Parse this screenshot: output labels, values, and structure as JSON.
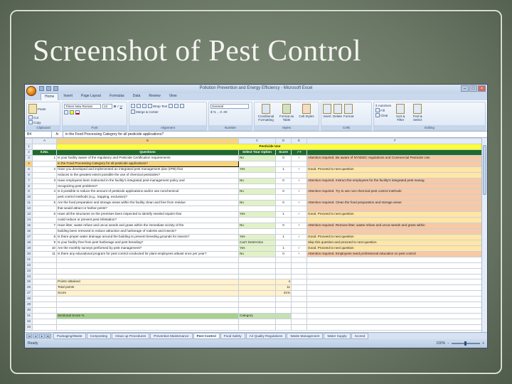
{
  "slide": {
    "title": "Screenshot of Pest Control"
  },
  "window": {
    "title": "Pollution Prevention and Energy Efficiency - Microsoft Excel"
  },
  "ribbon_tabs": [
    "Home",
    "Insert",
    "Page Layout",
    "Formulas",
    "Data",
    "Review",
    "View"
  ],
  "ribbon": {
    "clipboard": {
      "label": "Clipboard",
      "paste": "Paste",
      "cut": "Cut",
      "copy": "Copy",
      "format_painter": "Format Painter"
    },
    "font": {
      "label": "Font",
      "font_name": "Times New Roman",
      "font_size": "12"
    },
    "alignment": {
      "label": "Alignment",
      "wrap": "Wrap Text",
      "merge": "Merge & Center"
    },
    "number": {
      "label": "Number",
      "format": "General"
    },
    "styles": {
      "label": "Styles",
      "conditional": "Conditional Formatting",
      "format_table": "Format as Table",
      "cell_styles": "Cell Styles"
    },
    "cells": {
      "label": "Cells",
      "insert": "Insert",
      "delete": "Delete",
      "format": "Format"
    },
    "editing": {
      "label": "Editing",
      "autosum": "AutoSum",
      "fill": "Fill",
      "clear": "Clear",
      "sort": "Sort & Filter",
      "find": "Find & Select"
    }
  },
  "formula_bar": {
    "name_box": "B4",
    "fx": "fx",
    "content": "in the Food Processing Category for all pesticide applications?"
  },
  "sheet": {
    "col_heads": [
      "",
      "A",
      "B",
      "C",
      "D",
      "E",
      "F"
    ],
    "row1_title": "Pesticide Use",
    "headers": [
      "S.No.",
      "Questions",
      "Select Your Option",
      "Score",
      "✓×",
      ""
    ],
    "rows": [
      [
        "1",
        "Is your facility aware of the regulatory and Pesticide Certification requirements",
        "No",
        "0",
        "×",
        "Attention required. Be aware of NYSDEC regulations and Commercial Pesticide Use"
      ],
      [
        "",
        "in the Food Processing Category for all pesticide applications?",
        "",
        "",
        "",
        ""
      ],
      [
        "2",
        "Have you developed and implemented an integrated pest management plan (IPM) that",
        "Yes",
        "1",
        "✓",
        "Good. Proceed to next question"
      ],
      [
        "",
        "reduces to the greatest extent possible the use of chemical pesticides?",
        "",
        "",
        "",
        ""
      ],
      [
        "3",
        "Have employees been instructed in the facility's integrated pest-management policy and",
        "No",
        "0",
        "×",
        "Attention required. Instruct the employees for the facility's integrated pest manag"
      ],
      [
        "",
        "recognizing pest problems?",
        "",
        "",
        "",
        ""
      ],
      [
        "4",
        "Is it possible to reduce the amount of pesticide applications and/or use nonchemical",
        "No",
        "0",
        "×",
        "Attention required. Try to use non-chemical pest control methods"
      ],
      [
        "",
        "pest control methods (e.g., trapping, exclusion)?",
        "",
        "",
        "",
        ""
      ],
      [
        "5",
        "Are the food preparation and storage areas within the facility clean and free from residue",
        "No",
        "0",
        "×",
        "Attention required. Clean the food preparation and storage areas"
      ],
      [
        "",
        "that would attract or harbor pests?",
        "",
        "",
        "",
        ""
      ],
      [
        "6",
        "Have all the structures on the premises been inspected to identify needed repairs that",
        "Yes",
        "1",
        "✓",
        "Good. Proceed to next question"
      ],
      [
        "",
        "could reduce or prevent pest infestation?",
        "",
        "",
        "",
        ""
      ],
      [
        "7",
        "Have litter, waste refuse and uncut weeds and grass within the immediate vicinity of the",
        "No",
        "0",
        "×",
        "Attention required. Remove litter, waste refuse and uncut weeds and grass within"
      ],
      [
        "",
        "building been removed to reduce attraction and harborage of rodents and insects?",
        "",
        "",
        "",
        ""
      ],
      [
        "8",
        "Is there proper water drainage around the building to prevent breeding grounds for insects?",
        "Yes",
        "1",
        "✓",
        "Good. Proceed to next question"
      ],
      [
        "9",
        "Is your facility free from pest harborage and pest breeding?",
        "Can't Determine",
        "",
        "",
        "Skip this question and proceed to next question"
      ],
      [
        "10",
        "Are the monthly surveys performed by pest management?",
        "Yes",
        "1",
        "✓",
        "Good. Proceed to next question"
      ],
      [
        "11",
        "Is there any educational program for pest control conducted for plant employees atleast once per year?",
        "No",
        "0",
        "×",
        "Attention required. Employees need professional education on pest control"
      ]
    ],
    "summary": [
      {
        "label": "Points obtained",
        "value": "4"
      },
      {
        "label": "Total points",
        "value": "11"
      },
      {
        "label": "Score",
        "value": "41%"
      }
    ],
    "sectional": {
      "label": "Sectional Score %",
      "value": "Category"
    }
  },
  "sheet_tabs": [
    "Packaging/Waste",
    "Composting",
    "Clean up Procedures",
    "Preventive Maintenance",
    "Pest Control",
    "Food Safety",
    "Air Quality Regulations",
    "Waste Management",
    "Water Supply",
    "Scored"
  ],
  "active_sheet": "Pest Control",
  "status": {
    "ready": "Ready",
    "zoom": "100%"
  },
  "colors": {
    "header_green": "#1f6b2c",
    "title_yellow": "#ffff33",
    "attention": "#f7c9a6",
    "good": "#ffe6a6"
  }
}
